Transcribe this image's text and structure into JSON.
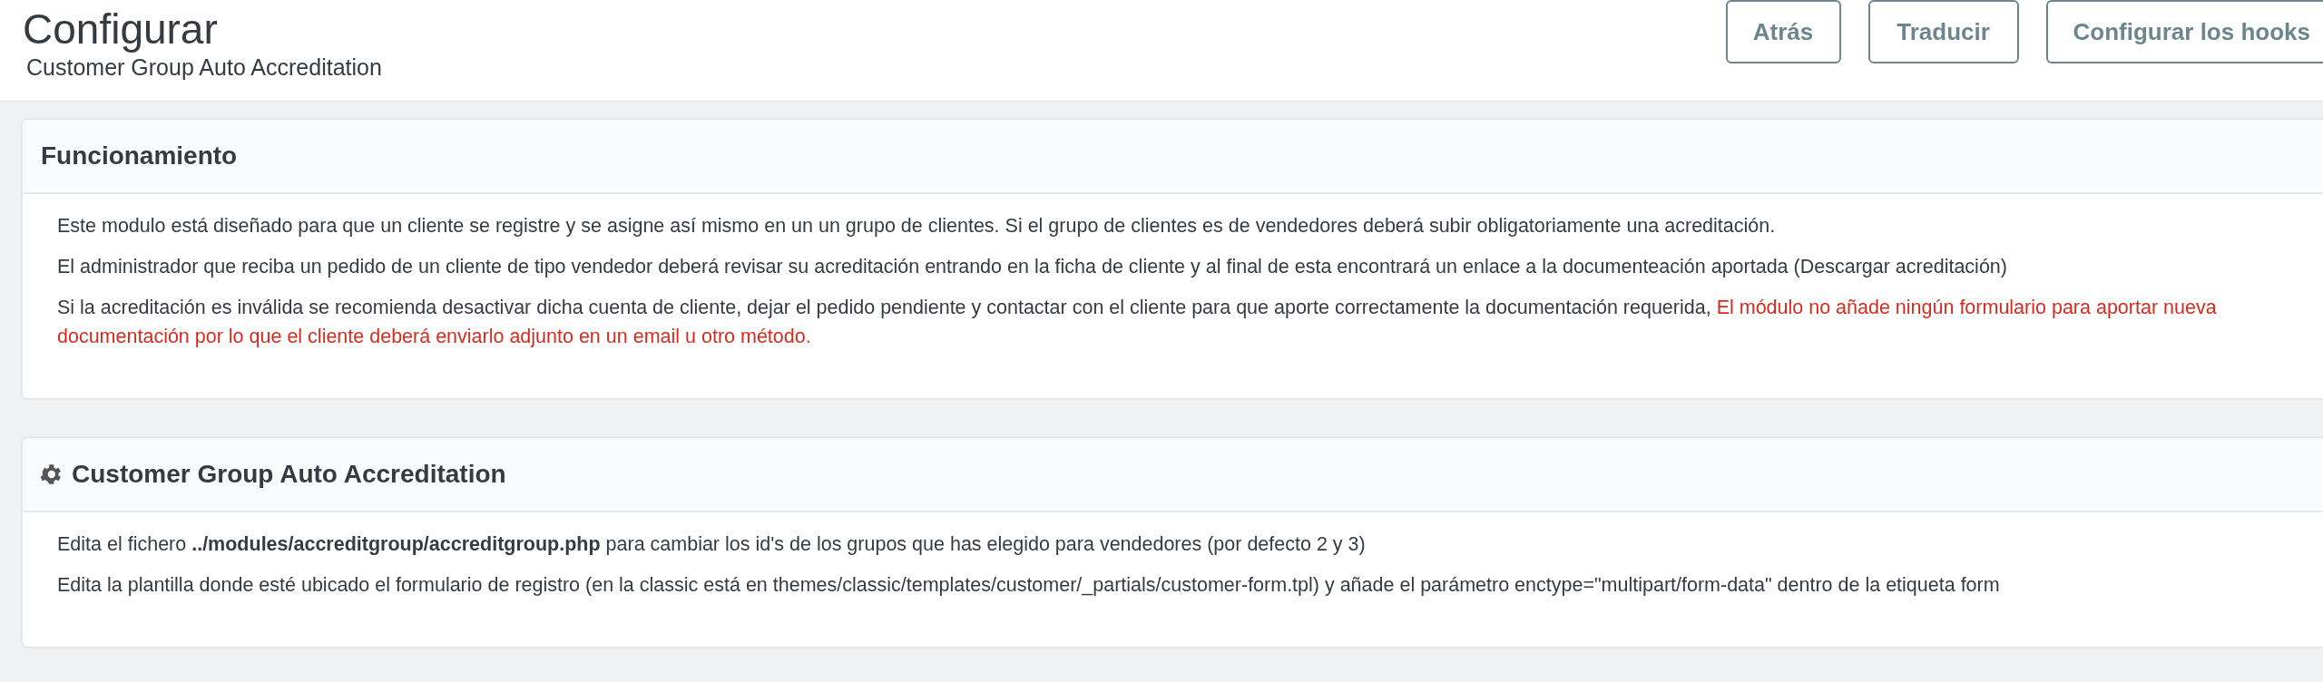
{
  "header": {
    "title": "Configurar",
    "subtitle": "Customer Group Auto Accreditation",
    "buttons": [
      "Atrás",
      "Traducir",
      "Configurar los hooks"
    ]
  },
  "panels": [
    {
      "title": "Funcionamiento",
      "kind": "plain",
      "paragraphs": [
        {
          "text": "Este modulo está diseñado para que un cliente se registre y se asigne así mismo en un un grupo de clientes. Si el grupo de clientes es de vendedores deberá subir obligatoriamente una acreditación."
        },
        {
          "text": "El administrador que reciba un pedido de un cliente de tipo vendedor deberá revisar su acreditación entrando en la ficha de cliente y al final de esta encontrará un enlace a la documenteación aportada (Descargar acreditación)"
        },
        {
          "text": "Si la acreditación es inválida se recomienda desactivar dicha cuenta de cliente, dejar el pedido pendiente y contactar con el cliente para que aporte correctamente la documentación requerida,",
          "warning": "El módulo no añade ningún formulario para aportar nueva documentación por lo que el cliente deberá enviarlo adjunto en un email u otro método."
        }
      ]
    },
    {
      "title": "Customer Group Auto Accreditation",
      "kind": "settings",
      "paragraphs": [
        {
          "text": "Edita el fichero **../modules/accreditgroup/accreditgroup.php** para cambiar los id's de los grupos que has elegido para vendedores (por defecto 2 y 3)"
        },
        {
          "text": "Edita la plantilla donde esté ubicado el formulario de registro (en la classic está en themes/classic/templates/customer/_partials/customer-form.tpl) y añade el parámetro enctype=\"multipart/form-data\" dentro de la etiqueta form"
        }
      ]
    }
  ]
}
